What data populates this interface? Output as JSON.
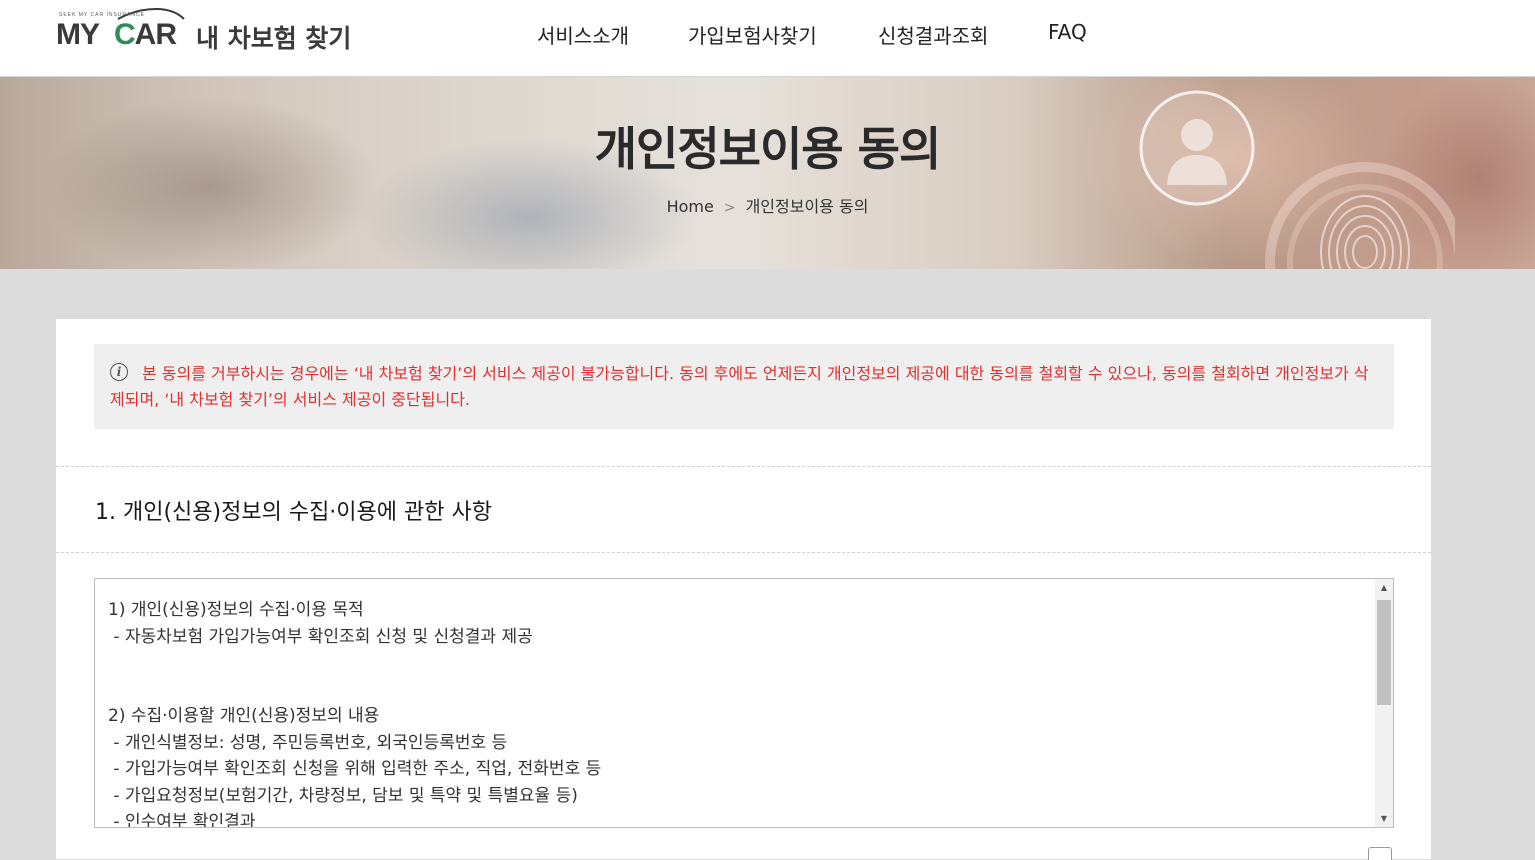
{
  "header": {
    "logo": {
      "tagline": "SEEK MY CAR INSURANCE",
      "brand_my": "MY",
      "brand_car_c": "C",
      "brand_car_rest": "AR",
      "service_name": "내 차보험 찾기"
    },
    "nav": [
      {
        "label": "서비스소개"
      },
      {
        "label": "가입보험사찾기"
      },
      {
        "label": "신청결과조회"
      },
      {
        "label": "FAQ"
      }
    ]
  },
  "hero": {
    "title": "개인정보이용 동의",
    "breadcrumb": {
      "home": "Home",
      "separator": ">",
      "current": "개인정보이용 동의"
    }
  },
  "notice": {
    "icon": "info-icon",
    "text": "본 동의를 거부하시는 경우에는 ‘내 차보험 찾기’의 서비스 제공이 불가능합니다. 동의 후에도 언제든지 개인정보의 제공에 대한 동의를 철회할 수 있으나, 동의를 철회하면 개인정보가 삭제되며, ‘내 차보험 찾기’의 서비스 제공이 중단됩니다."
  },
  "section": {
    "title": "1. 개인(신용)정보의 수집·이용에 관한 사항"
  },
  "terms": {
    "lines": [
      "1) 개인(신용)정보의 수집·이용 목적",
      " - 자동차보험 가입가능여부 확인조회 신청 및 신청결과 제공",
      "",
      "",
      "2) 수집·이용할 개인(신용)정보의 내용",
      " - 개인식별정보: 성명, 주민등록번호, 외국인등록번호 등",
      " - 가입가능여부 확인조회 신청을 위해 입력한 주소, 직업, 전화번호 등",
      " - 가입요청정보(보험기간, 차량정보, 담보 및 특약 및 특별요율 등)",
      " - 인수여부 확인결과"
    ]
  },
  "colors": {
    "notice_text": "#e03030",
    "logo_accent": "#2e8b57",
    "page_bg": "#dcdcdc"
  }
}
